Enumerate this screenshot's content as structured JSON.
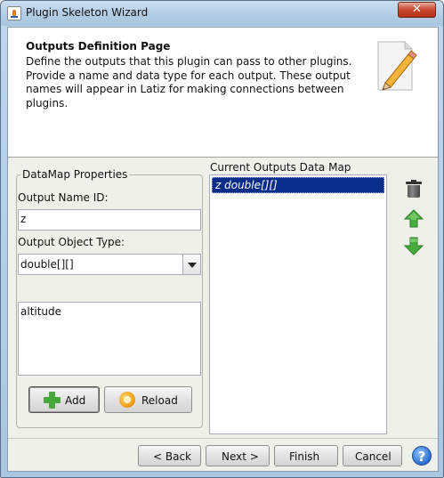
{
  "window": {
    "title": "Plugin Skeleton Wizard",
    "close_label": "✕"
  },
  "header": {
    "title": "Outputs Definition Page",
    "description": "Define the outputs that this plugin can pass to other plugins. Provide a name and data type for each output. These output names will appear in Latiz for making connections between plugins."
  },
  "props": {
    "legend": "DataMap Properties",
    "name_label": "Output Name ID:",
    "name_value": "z",
    "type_label": "Output Object Type:",
    "type_value": "double[][]",
    "description_value": "altitude",
    "add_label": "Add",
    "reload_label": "Reload"
  },
  "outputs": {
    "label": "Current Outputs Data Map",
    "items": [
      "z double[][]"
    ]
  },
  "footer": {
    "back_label": "< Back",
    "next_label": "Next >",
    "finish_label": "Finish",
    "cancel_label": "Cancel",
    "help_label": "?"
  },
  "colors": {
    "selection": "#0a2d8a",
    "arrow_green": "#3fa63a",
    "frame_blue": "#b3cde6"
  }
}
